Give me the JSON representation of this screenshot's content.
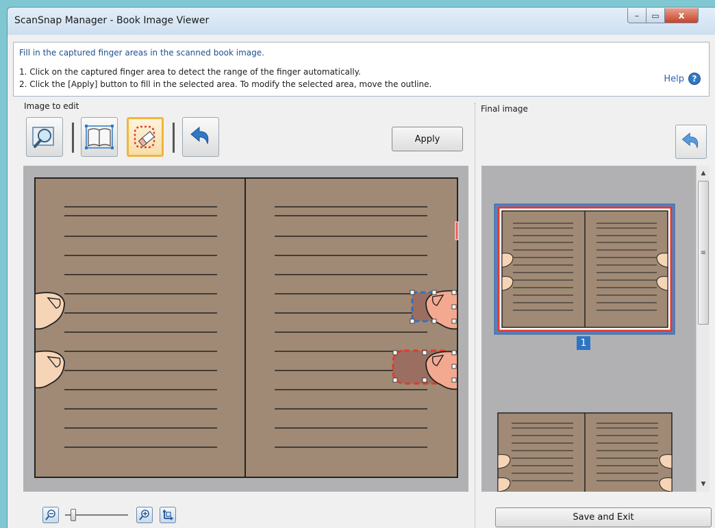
{
  "window": {
    "title": "ScanSnap Manager - Book Image Viewer",
    "controls": {
      "minimize": "–",
      "maximize": "▭",
      "close": "x"
    }
  },
  "instructions": {
    "heading": "Fill in the captured finger areas in the scanned book image.",
    "step1": "1. Click on the captured finger area to detect the range of the finger automatically.",
    "step2": "2. Click the [Apply] button to fill in the selected area. To modify the selected area, move the outline.",
    "help_label": "Help",
    "help_icon": "?"
  },
  "editor": {
    "label": "Image to edit",
    "tools": [
      {
        "name": "preview-tool",
        "icon": "magnifier-icon",
        "selected": false
      },
      {
        "name": "page-split-tool",
        "icon": "book-crop-icon",
        "selected": false
      },
      {
        "name": "finger-eraser-tool",
        "icon": "eraser-icon",
        "selected": true
      },
      {
        "name": "undo-tool",
        "icon": "undo-icon",
        "selected": false
      }
    ],
    "apply_label": "Apply"
  },
  "final": {
    "label": "Final image",
    "page_number": "1"
  },
  "footer": {
    "zoom_out_icon": "zoom-out-icon",
    "zoom_in_icon": "zoom-in-icon",
    "fit_icon": "fit-page-icon",
    "zoom_level": 0.1,
    "save_label": "Save and Exit"
  },
  "colors": {
    "page": "#a08a75",
    "finger": "#f6d4b6",
    "selected_outline": "#e13a2e",
    "detected_outline": "#2f6fc3",
    "accent": "#f0b53a"
  }
}
